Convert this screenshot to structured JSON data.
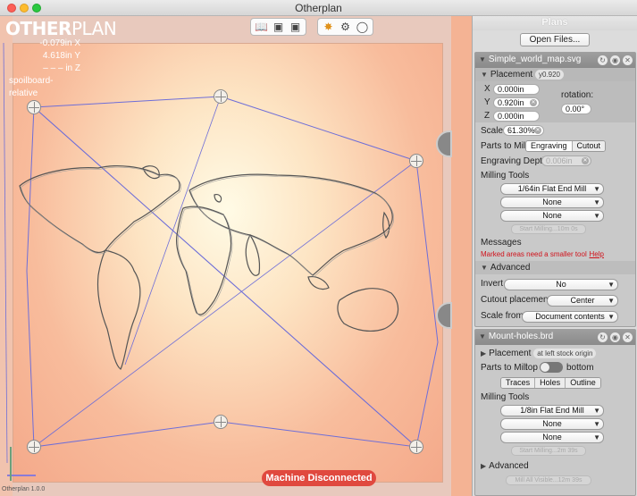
{
  "window": {
    "title": "Otherplan"
  },
  "brand": {
    "logo_bold": "OTHER",
    "logo_thin": "PLAN"
  },
  "readout": {
    "x": "-0.079in X",
    "y": "4.618in Y",
    "z": "– – – in Z",
    "reference": "spoilboard-relative"
  },
  "toolbar": {
    "group1": [
      "open-book-icon",
      "cart-icon",
      "box-icon"
    ],
    "group2": [
      "bit-icon",
      "tools-icon",
      "palette-icon"
    ]
  },
  "status": {
    "connection": "Machine Disconnected",
    "version": "Otherplan 1.0.0"
  },
  "panel": {
    "title": "Plans",
    "open_files": "Open Files...",
    "plan1": {
      "file": "Simple_world_map.svg",
      "placement_label": "Placement",
      "placement_badge": "y0.920",
      "x_label": "X",
      "x_value": "0.000in",
      "y_label": "Y",
      "y_value": "0.920in",
      "z_label": "Z",
      "z_value": "0.000in",
      "rotation_label": "rotation:",
      "rotation_value": "0.00°",
      "scale_label": "Scale",
      "scale_value": "61.30%",
      "parts_label": "Parts to Mill",
      "parts_options": [
        "Engraving",
        "Cutout"
      ],
      "depth_label": "Engraving Depth",
      "depth_value": "0.006in",
      "tools_label": "Milling Tools",
      "tool1": "1/64in Flat End Mill",
      "tool2": "None",
      "tool3": "None",
      "start_button": "Start Milling...10m 0s",
      "messages_label": "Messages",
      "message_text": "Marked areas need a smaller tool",
      "help_link": "Help",
      "advanced_label": "Advanced",
      "invert_label": "Invert",
      "invert_value": "No",
      "cutout_label": "Cutout placement",
      "cutout_value": "Center",
      "scale_from_label": "Scale from",
      "scale_from_value": "Document contents"
    },
    "plan2": {
      "file": "Mount-holes.brd",
      "placement_label": "Placement",
      "placement_badge": "at left stock origin",
      "parts_label": "Parts to Mill",
      "side_top": "top",
      "side_bottom": "bottom",
      "parts_options": [
        "Traces",
        "Holes",
        "Outline"
      ],
      "tools_label": "Milling Tools",
      "tool1": "1/8in Flat End Mill",
      "tool2": "None",
      "tool3": "None",
      "start_button": "Start Milling...2m 39s",
      "advanced_label": "Advanced",
      "mill_all": "Mill All Visible...12m 39s"
    }
  },
  "colors": {
    "accent": "#e0921c",
    "danger": "#e0493f",
    "selection_line": "#6e6ed8"
  }
}
